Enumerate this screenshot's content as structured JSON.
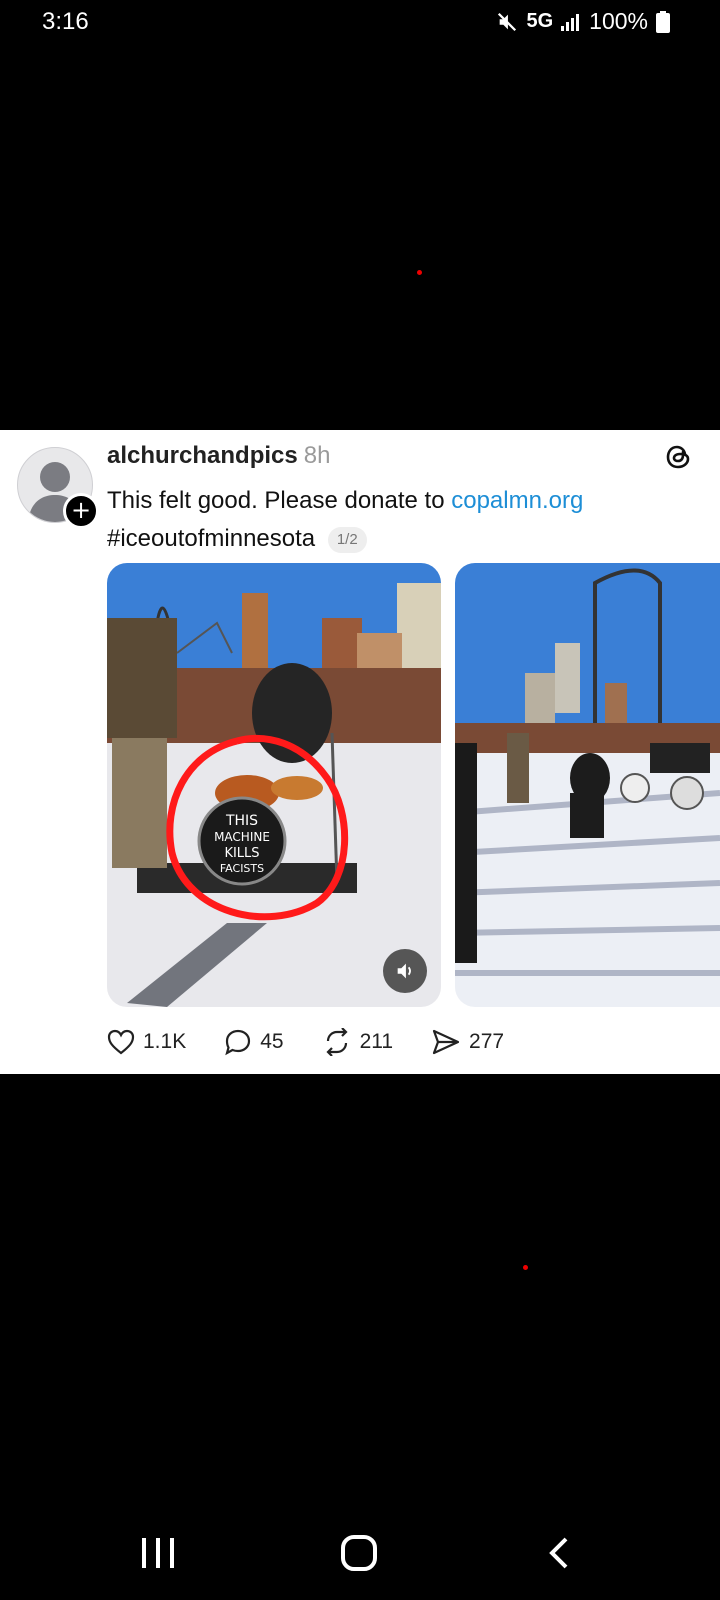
{
  "status_bar": {
    "time": "3:16",
    "network": "5G",
    "battery": "100%",
    "icons": [
      "mute-icon",
      "signal-icon",
      "battery-icon"
    ]
  },
  "post": {
    "username": "alchurchandpics",
    "time_ago": "8h",
    "caption_text": "This felt good. Please donate to ",
    "link": "copalmn.org",
    "hashtag": "#iceoutofminnesota",
    "pager": "1/2",
    "drum_text": [
      "THIS",
      "MACHINE",
      "KILLS",
      "FACISTS"
    ],
    "actions": {
      "likes": "1.1K",
      "comments": "45",
      "reposts": "211",
      "shares": "277"
    }
  },
  "colors": {
    "link": "#1d8ed6",
    "annotation_circle": "#ff1a1a",
    "background": "#000000",
    "card": "#ffffff"
  }
}
